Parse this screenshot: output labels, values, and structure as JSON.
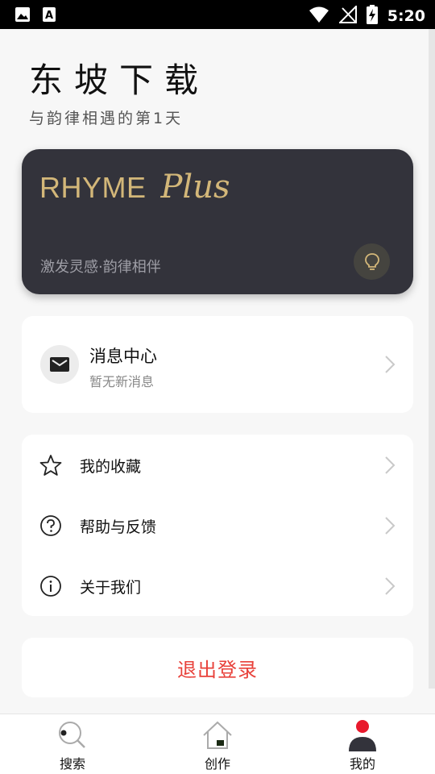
{
  "status_bar": {
    "time": "5:20",
    "icons": [
      "image-notification-icon",
      "a-notification-icon",
      "wifi-icon",
      "no-signal-icon",
      "battery-charging-icon"
    ]
  },
  "header": {
    "title": "东坡下载",
    "subtitle": "与韵律相遇的第1天"
  },
  "plus_card": {
    "brand_text": "RHYME",
    "brand_plus": "Plus",
    "tagline": "激发灵感·韵律相伴",
    "accent_color": "#d3b779",
    "icon": "lightbulb-icon"
  },
  "message_center": {
    "title": "消息中心",
    "subtitle": "暂无新消息",
    "icon": "mail-icon"
  },
  "menu": {
    "items": [
      {
        "label": "我的收藏",
        "icon": "star-icon"
      },
      {
        "label": "帮助与反馈",
        "icon": "question-icon"
      },
      {
        "label": "关于我们",
        "icon": "info-icon"
      }
    ]
  },
  "logout": {
    "label": "退出登录",
    "color": "#e8413a"
  },
  "bottom_nav": {
    "items": [
      {
        "label": "搜索",
        "icon": "search-icon"
      },
      {
        "label": "创作",
        "icon": "home-icon"
      },
      {
        "label": "我的",
        "icon": "profile-icon",
        "active": true
      }
    ]
  }
}
